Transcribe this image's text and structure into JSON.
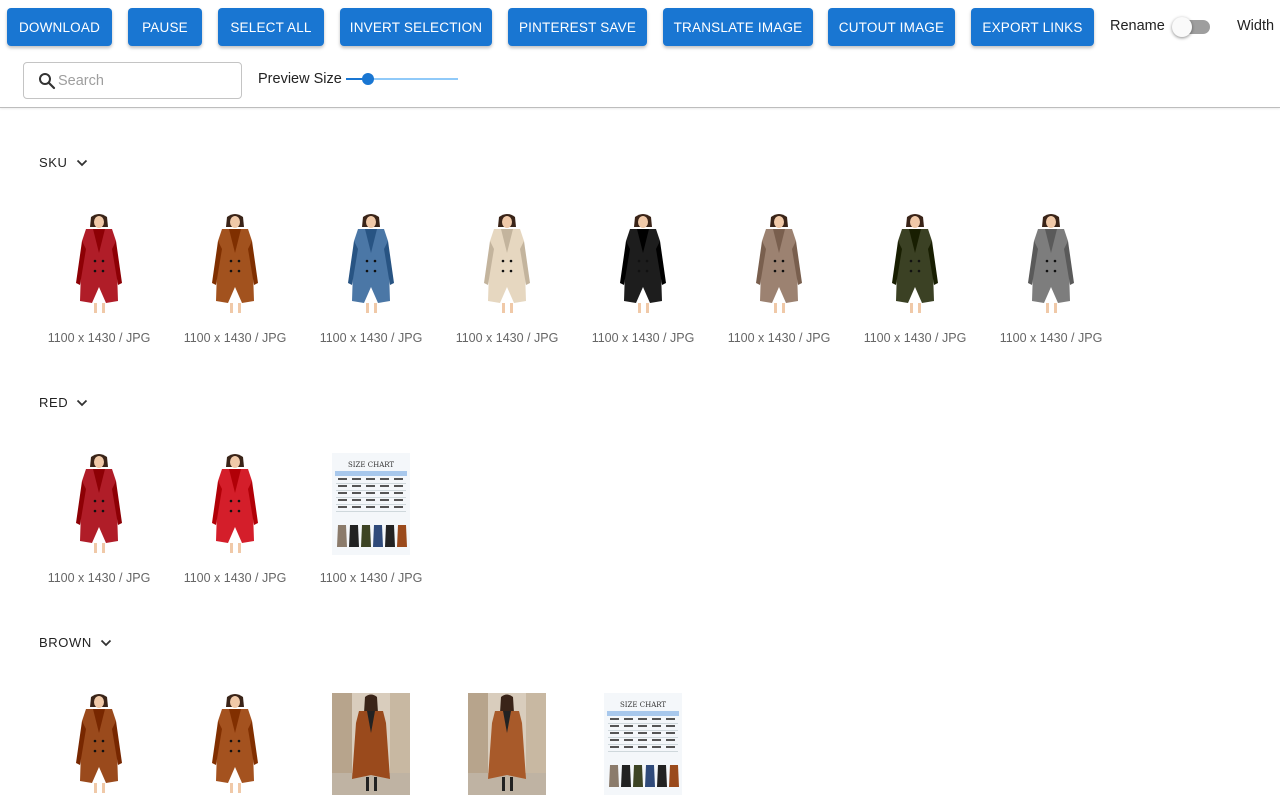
{
  "toolbar": {
    "buttons": [
      {
        "id": "download",
        "label": "DOWNLOAD"
      },
      {
        "id": "pause",
        "label": "PAUSE"
      },
      {
        "id": "select-all",
        "label": "SELECT ALL"
      },
      {
        "id": "invert-selection",
        "label": "INVERT SELECTION"
      },
      {
        "id": "pinterest-save",
        "label": "PINTEREST SAVE"
      },
      {
        "id": "translate-image",
        "label": "TRANSLATE IMAGE"
      },
      {
        "id": "cutout-image",
        "label": "CUTOUT IMAGE"
      },
      {
        "id": "export-links",
        "label": "EXPORT LINKS"
      }
    ],
    "rename_label": "Rename",
    "rename_enabled": false,
    "width_label": "Width",
    "accent": "#1976d2"
  },
  "search": {
    "placeholder": "Search",
    "value": ""
  },
  "preview": {
    "label": "Preview Size",
    "value_fraction": 0.2
  },
  "sections": [
    {
      "title": "SKU",
      "images": [
        {
          "caption": "1100 x 1430 / JPG",
          "kind": "coat",
          "color": "#b01d28"
        },
        {
          "caption": "1100 x 1430 / JPG",
          "kind": "coat",
          "color": "#a2521e"
        },
        {
          "caption": "1100 x 1430 / JPG",
          "kind": "coat",
          "color": "#4b77a6"
        },
        {
          "caption": "1100 x 1430 / JPG",
          "kind": "coat",
          "color": "#e6d7c0"
        },
        {
          "caption": "1100 x 1430 / JPG",
          "kind": "coat",
          "color": "#1d1d1d"
        },
        {
          "caption": "1100 x 1430 / JPG",
          "kind": "coat",
          "color": "#9c8271"
        },
        {
          "caption": "1100 x 1430 / JPG",
          "kind": "coat",
          "color": "#3b4124"
        },
        {
          "caption": "1100 x 1430 / JPG",
          "kind": "coat",
          "color": "#7d7d7d"
        }
      ]
    },
    {
      "title": "RED",
      "images": [
        {
          "caption": "1100 x 1430 / JPG",
          "kind": "coat",
          "color": "#b01d28"
        },
        {
          "caption": "1100 x 1430 / JPG",
          "kind": "coat",
          "color": "#d41e2a"
        },
        {
          "caption": "1100 x 1430 / JPG",
          "kind": "chart",
          "color": "#ffffff",
          "chart_title": "SIZE CHART"
        }
      ]
    },
    {
      "title": "BROWN",
      "images": [
        {
          "caption": "",
          "kind": "coat",
          "color": "#9a4a1c"
        },
        {
          "caption": "",
          "kind": "coat",
          "color": "#a4521f"
        },
        {
          "caption": "",
          "kind": "photo",
          "color": "#9a4a1c"
        },
        {
          "caption": "",
          "kind": "photo",
          "color": "#a85a2a"
        },
        {
          "caption": "",
          "kind": "chart",
          "color": "#ffffff",
          "chart_title": "SIZE CHART"
        }
      ]
    }
  ]
}
